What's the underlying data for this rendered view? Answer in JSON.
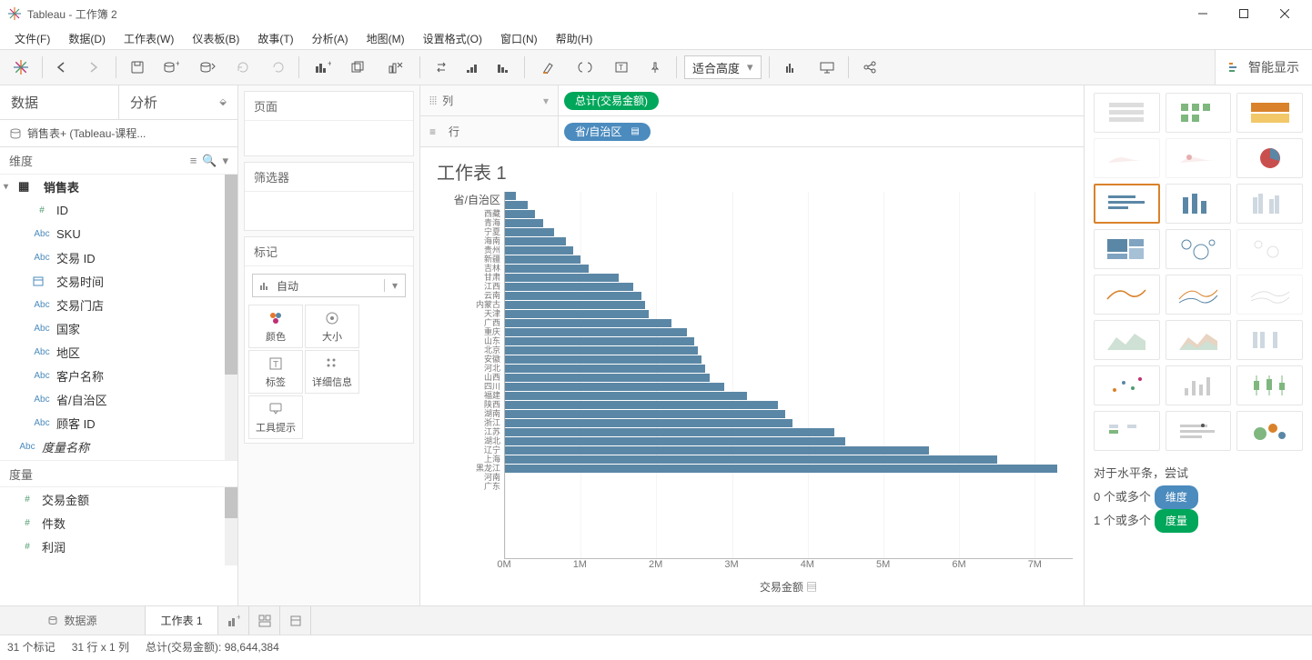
{
  "window": {
    "app": "Tableau",
    "title": "工作簿 2"
  },
  "menu": [
    "文件(F)",
    "数据(D)",
    "工作表(W)",
    "仪表板(B)",
    "故事(T)",
    "分析(A)",
    "地图(M)",
    "设置格式(O)",
    "窗口(N)",
    "帮助(H)"
  ],
  "toolbar": {
    "fit": "适合高度",
    "showme": "智能显示"
  },
  "sidepanel": {
    "tabs": [
      "数据",
      "分析"
    ],
    "connection": "销售表+ (Tableau-课程...",
    "dim_label": "维度",
    "table_name": "销售表",
    "dims": [
      {
        "type": "#",
        "name": "ID"
      },
      {
        "type": "Abc",
        "name": "SKU"
      },
      {
        "type": "Abc",
        "name": "交易 ID"
      },
      {
        "type": "📅",
        "name": "交易时间"
      },
      {
        "type": "Abc",
        "name": "交易门店"
      },
      {
        "type": "Abc",
        "name": "国家"
      },
      {
        "type": "Abc",
        "name": "地区"
      },
      {
        "type": "Abc",
        "name": "客户名称"
      },
      {
        "type": "Abc",
        "name": "省/自治区"
      },
      {
        "type": "Abc",
        "name": "顾客 ID"
      },
      {
        "type": "Abc",
        "name": "度量名称",
        "italic": true
      }
    ],
    "meas_label": "度量",
    "meas": [
      {
        "type": "#",
        "name": "交易金额"
      },
      {
        "type": "#",
        "name": "件数"
      },
      {
        "type": "#",
        "name": "利润"
      }
    ]
  },
  "cards": {
    "pages": "页面",
    "filters": "筛选器",
    "marks": "标记",
    "mark_type": "自动",
    "markbtns": [
      "颜色",
      "大小",
      "标签",
      "详细信息",
      "工具提示"
    ]
  },
  "shelves": {
    "col_label": "列",
    "col_pill": "总计(交易金额)",
    "row_label": "行",
    "row_pill": "省/自治区"
  },
  "chart": {
    "title": "工作表 1",
    "y_axis_title": "省/自治区",
    "x_axis_title": "交易金额",
    "x_ticks": [
      "0M",
      "1M",
      "2M",
      "3M",
      "4M",
      "5M",
      "6M",
      "7M"
    ]
  },
  "chart_data": {
    "type": "bar",
    "orientation": "horizontal",
    "xlabel": "交易金额",
    "ylabel": "省/自治区",
    "xlim": [
      0,
      7500000
    ],
    "categories": [
      "西藏",
      "青海",
      "宁夏",
      "海南",
      "贵州",
      "新疆",
      "吉林",
      "甘肃",
      "江西",
      "云南",
      "内蒙古",
      "天津",
      "广西",
      "重庆",
      "山东",
      "北京",
      "安徽",
      "河北",
      "山西",
      "四川",
      "福建",
      "陕西",
      "湖南",
      "浙江",
      "江苏",
      "湖北",
      "辽宁",
      "上海",
      "黑龙江",
      "河南",
      "广东"
    ],
    "values": [
      150000,
      300000,
      400000,
      500000,
      650000,
      800000,
      900000,
      1000000,
      1100000,
      1500000,
      1700000,
      1800000,
      1850000,
      1900000,
      2200000,
      2400000,
      2500000,
      2550000,
      2600000,
      2650000,
      2700000,
      2900000,
      3200000,
      3600000,
      3700000,
      3800000,
      4350000,
      4500000,
      5600000,
      6500000,
      7300000
    ]
  },
  "showme_hint": {
    "line1": "对于水平条，尝试",
    "line2_pre": "0 个或多个",
    "line2_pill": "维度",
    "line3_pre": "1 个或多个",
    "line3_pill": "度量"
  },
  "tabs": {
    "datasource": "数据源",
    "sheet1": "工作表 1"
  },
  "status": {
    "marks": "31 个标记",
    "rows": "31 行 x 1 列",
    "sum": "总计(交易金额): 98,644,384"
  }
}
